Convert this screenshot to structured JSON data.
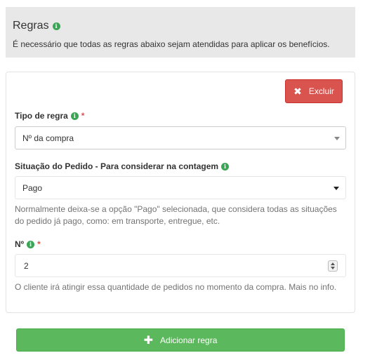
{
  "header": {
    "title": "Regras",
    "description": "É necessário que todas as regras abaixo sejam atendidas para aplicar os benefícios."
  },
  "rule": {
    "delete_label": "Excluir",
    "type": {
      "label": "Tipo de regra",
      "required_mark": "*",
      "selected": "Nº da compra"
    },
    "status": {
      "label": "Situação do Pedido - Para considerar na contagem",
      "selected": "Pago",
      "help": "Normalmente deixa-se a opção \"Pago\" selecionada, que considera todas as situações do pedido já pago, como: em transporte, entregue, etc."
    },
    "number": {
      "label": "Nº",
      "required_mark": "*",
      "value": "2",
      "help": "O cliente irá atingir essa quantidade de pedidos no momento da compra. Mais no info."
    }
  },
  "add_rule_label": "Adicionar regra",
  "colors": {
    "danger": "#d9534f",
    "success": "#5cb85c",
    "info_icon": "#3aa655",
    "header_bg": "#e8e8e8"
  },
  "icons": {
    "info": "info-icon",
    "delete": "close-icon",
    "add": "plus-icon",
    "dropdown": "chevron-down-icon"
  }
}
